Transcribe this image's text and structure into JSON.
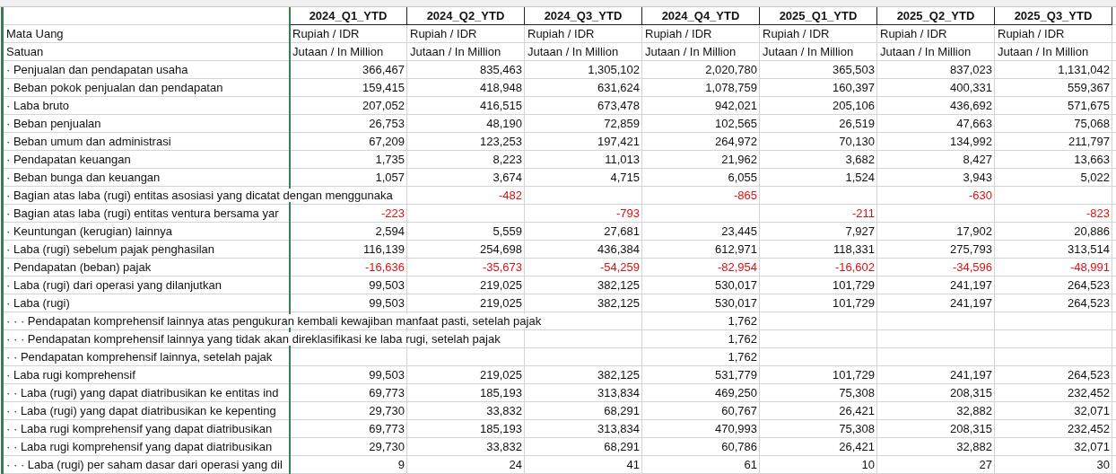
{
  "columns": [
    "2024_Q1_YTD",
    "2024_Q2_YTD",
    "2024_Q3_YTD",
    "2024_Q4_YTD",
    "2025_Q1_YTD",
    "2025_Q2_YTD",
    "2025_Q3_YTD"
  ],
  "info_rows": [
    {
      "label": "Mata Uang",
      "values": [
        "Rupiah / IDR",
        "Rupiah / IDR",
        "Rupiah / IDR",
        "Rupiah / IDR",
        "Rupiah / IDR",
        "Rupiah / IDR",
        "Rupiah / IDR"
      ]
    },
    {
      "label": "Satuan",
      "values": [
        "Jutaan / In Million",
        "Jutaan / In Million",
        "Jutaan / In Million",
        "Jutaan / In Million",
        "Jutaan / In Million",
        "Jutaan / In Million",
        "Jutaan / In Million"
      ]
    }
  ],
  "rows": [
    {
      "label": "· Penjualan dan pendapatan usaha",
      "kind": "normal",
      "values": [
        "366,467",
        "835,463",
        "1,305,102",
        "2,020,780",
        "365,503",
        "837,023",
        "1,131,042"
      ]
    },
    {
      "label": "· Beban pokok penjualan dan pendapatan",
      "kind": "normal",
      "values": [
        "159,415",
        "418,948",
        "631,624",
        "1,078,759",
        "160,397",
        "400,331",
        "559,367"
      ]
    },
    {
      "label": "· Laba bruto",
      "kind": "normal",
      "values": [
        "207,052",
        "416,515",
        "673,478",
        "942,021",
        "205,106",
        "436,692",
        "571,675"
      ]
    },
    {
      "label": "· Beban penjualan",
      "kind": "normal",
      "values": [
        "26,753",
        "48,190",
        "72,859",
        "102,565",
        "26,519",
        "47,663",
        "75,068"
      ]
    },
    {
      "label": "· Beban umum dan administrasi",
      "kind": "normal",
      "values": [
        "67,209",
        "123,253",
        "197,421",
        "264,972",
        "70,130",
        "134,992",
        "211,797"
      ]
    },
    {
      "label": "· Pendapatan keuangan",
      "kind": "normal",
      "values": [
        "1,735",
        "8,223",
        "11,013",
        "21,962",
        "3,682",
        "8,427",
        "13,663"
      ]
    },
    {
      "label": "· Beban bunga dan keuangan",
      "kind": "normal",
      "values": [
        "1,057",
        "3,674",
        "4,715",
        "6,055",
        "1,524",
        "3,943",
        "5,022"
      ]
    },
    {
      "label": "· Bagian atas laba (rugi) entitas asosiasi yang dicatat dengan menggunaka",
      "kind": "negative",
      "cells": [
        {
          "blank": true
        },
        {
          "value": "-482"
        },
        {
          "blank": true
        },
        {
          "value": "-865"
        },
        {
          "blank": true
        },
        {
          "value": "-630"
        },
        {
          "blank": true
        }
      ]
    },
    {
      "label": "· Bagian atas laba (rugi) entitas ventura bersama yar",
      "kind": "negative",
      "cells": [
        {
          "value": "-223"
        },
        {
          "blank": true
        },
        {
          "value": "-793"
        },
        {
          "blank": true
        },
        {
          "value": "-211"
        },
        {
          "blank": true
        },
        {
          "value": "-823"
        }
      ]
    },
    {
      "label": "· Keuntungan (kerugian) lainnya",
      "kind": "normal",
      "values": [
        "2,594",
        "5,559",
        "27,681",
        "23,445",
        "7,927",
        "17,902",
        "20,886"
      ]
    },
    {
      "label": "· Laba (rugi) sebelum pajak penghasilan",
      "kind": "normal",
      "values": [
        "116,139",
        "254,698",
        "436,384",
        "612,971",
        "118,331",
        "275,793",
        "313,514"
      ]
    },
    {
      "label": "· Pendapatan (beban) pajak",
      "kind": "negative",
      "values": [
        "-16,636",
        "-35,673",
        "-54,259",
        "-82,954",
        "-16,602",
        "-34,596",
        "-48,991"
      ]
    },
    {
      "label": "· Laba (rugi) dari operasi yang dilanjutkan",
      "kind": "normal",
      "values": [
        "99,503",
        "219,025",
        "382,125",
        "530,017",
        "101,729",
        "241,197",
        "264,523"
      ]
    },
    {
      "label": "· Laba (rugi)",
      "kind": "normal",
      "values": [
        "99,503",
        "219,025",
        "382,125",
        "530,017",
        "101,729",
        "241,197",
        "264,523"
      ]
    },
    {
      "label": "· · · Pendapatan komprehensif lainnya atas pengukuran kembali kewajiban manfaat pasti, setelah pajak",
      "kind": "normal",
      "cells": [
        {
          "blank": true
        },
        {
          "blank": true
        },
        {
          "blank": true
        },
        {
          "value": "1,762"
        },
        {
          "blank": true
        },
        {
          "blank": true
        },
        {
          "blank": true
        }
      ]
    },
    {
      "label": "· · · Pendapatan komprehensif lainnya yang tidak akan direklasifikasi ke laba rugi, setelah pajak",
      "kind": "normal",
      "cells": [
        {
          "blank": true
        },
        {
          "blank": true
        },
        {
          "blank": true
        },
        {
          "value": "1,762"
        },
        {
          "blank": true
        },
        {
          "blank": true
        },
        {
          "blank": true
        }
      ]
    },
    {
      "label": "· · Pendapatan komprehensif lainnya, setelah pajak",
      "kind": "normal",
      "cells": [
        {
          "blank": true
        },
        {
          "blank": true
        },
        {
          "blank": true
        },
        {
          "value": "1,762"
        },
        {
          "blank": true
        },
        {
          "blank": true
        },
        {
          "blank": true
        }
      ]
    },
    {
      "label": "· Laba rugi komprehensif",
      "kind": "normal",
      "values": [
        "99,503",
        "219,025",
        "382,125",
        "531,779",
        "101,729",
        "241,197",
        "264,523"
      ]
    },
    {
      "label": "· · Laba (rugi) yang dapat diatribusikan ke entitas ind",
      "kind": "normal",
      "values": [
        "69,773",
        "185,193",
        "313,834",
        "469,250",
        "75,308",
        "208,315",
        "232,452"
      ]
    },
    {
      "label": "· · Laba (rugi) yang dapat diatribusikan ke kepenting",
      "kind": "normal",
      "values": [
        "29,730",
        "33,832",
        "68,291",
        "60,767",
        "26,421",
        "32,882",
        "32,071"
      ]
    },
    {
      "label": "· · Laba rugi komprehensif yang dapat diatribusikan",
      "kind": "normal",
      "values": [
        "69,773",
        "185,193",
        "313,834",
        "470,993",
        "75,308",
        "208,315",
        "232,452"
      ]
    },
    {
      "label": "· · Laba rugi komprehensif yang dapat diatribusikan",
      "kind": "normal",
      "values": [
        "29,730",
        "33,832",
        "68,291",
        "60,786",
        "26,421",
        "32,882",
        "32,071"
      ]
    },
    {
      "label": "· · · Laba (rugi) per saham dasar dari operasi yang dil",
      "kind": "normal",
      "values": [
        "9",
        "24",
        "41",
        "61",
        "10",
        "27",
        "30"
      ]
    }
  ]
}
